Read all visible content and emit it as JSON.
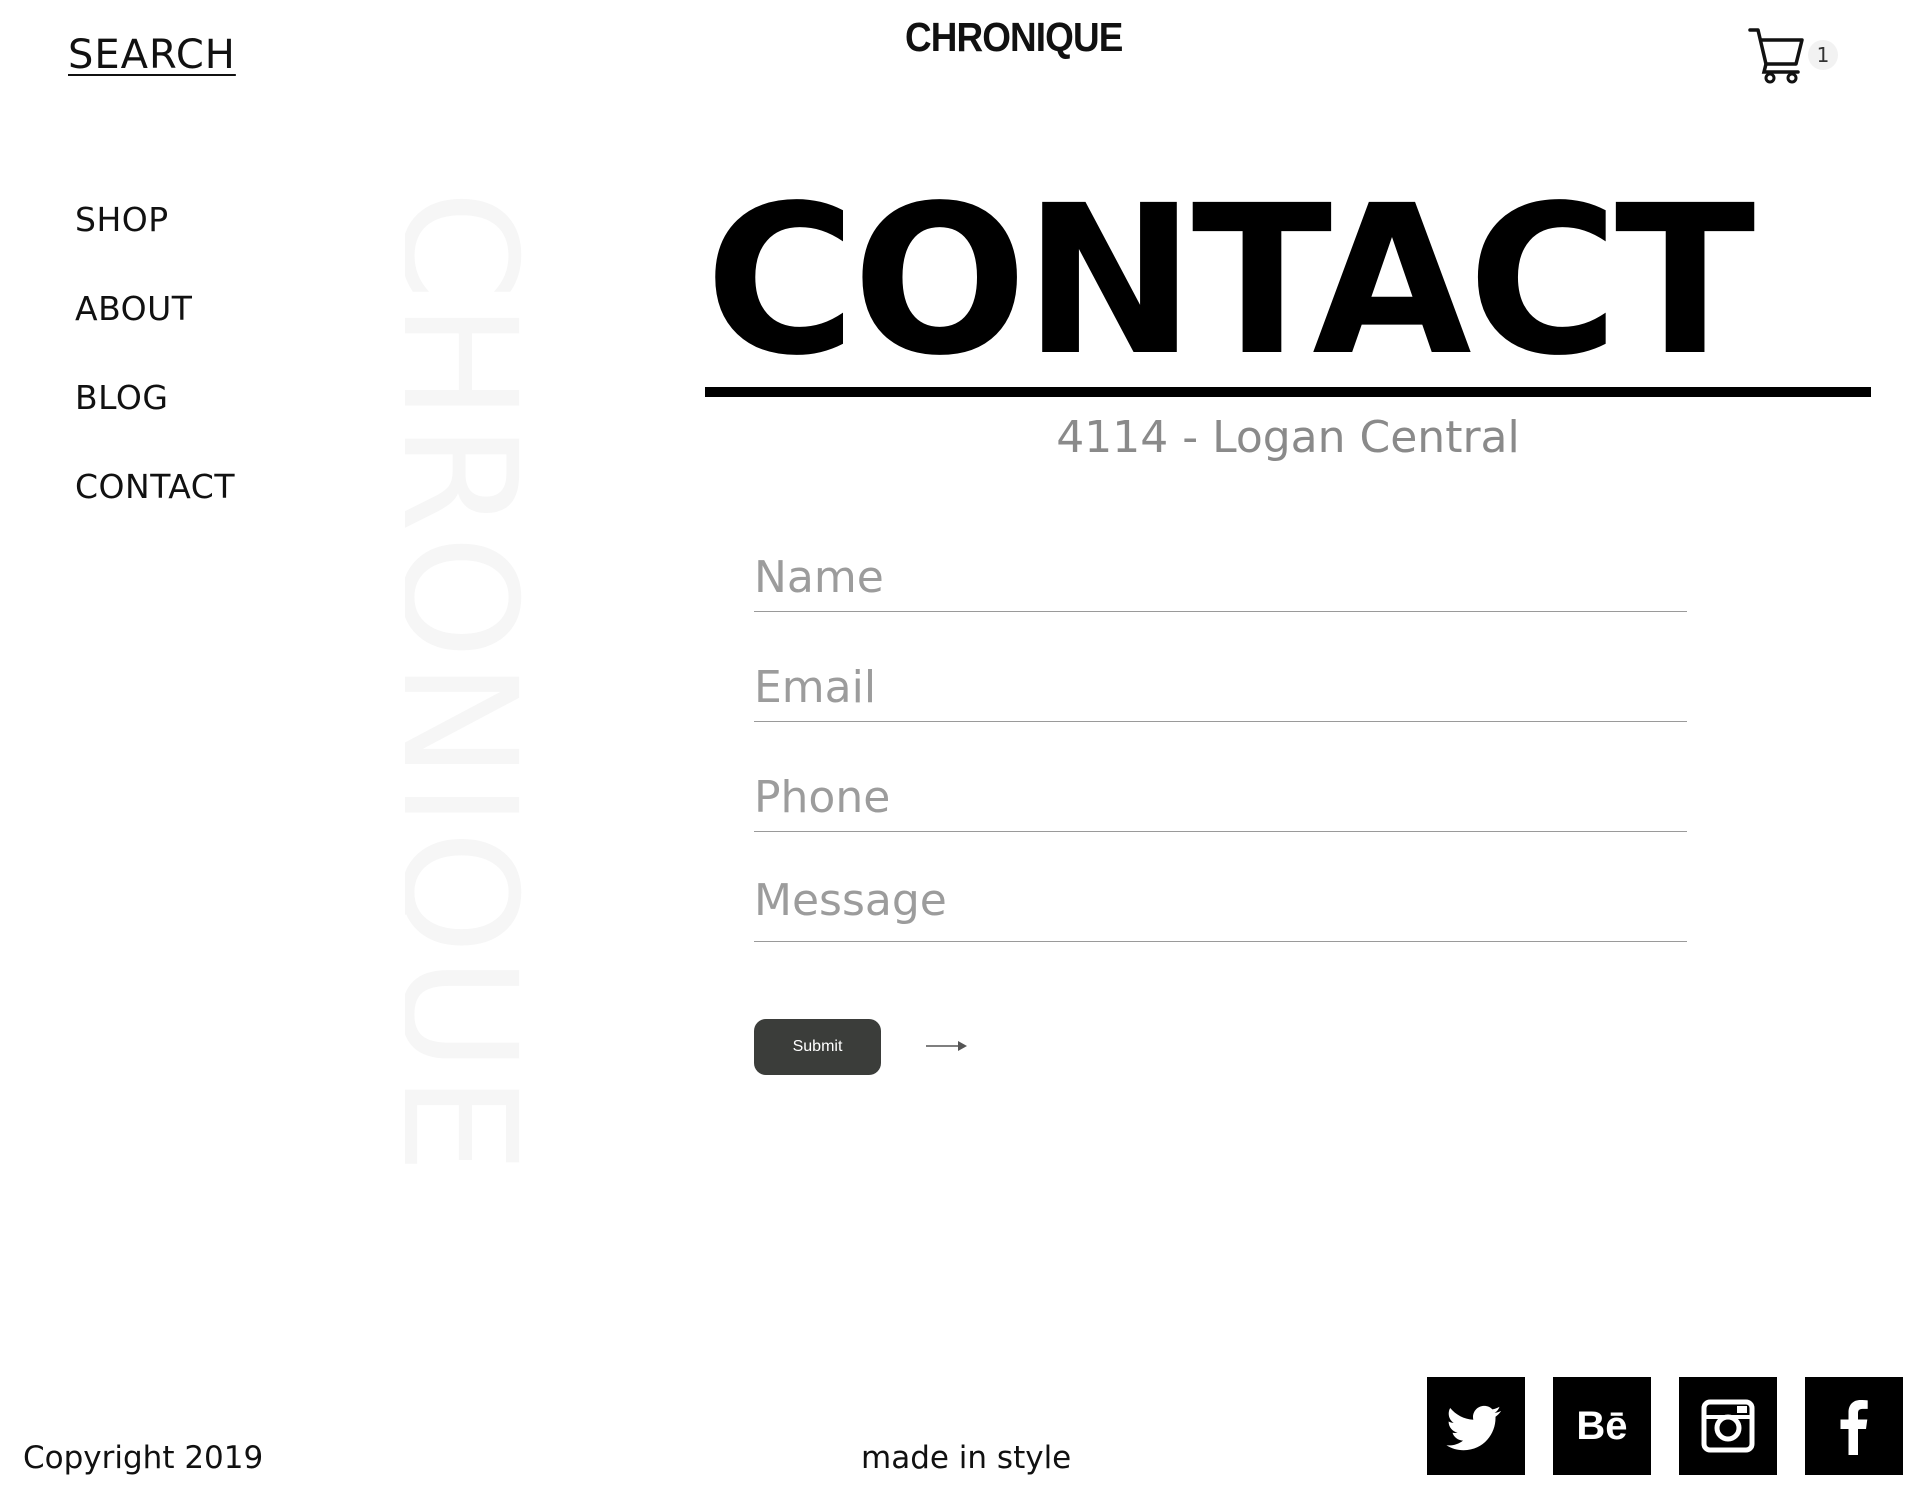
{
  "header": {
    "search_label": "SEARCH",
    "logo_text": "CHRONIQUE",
    "cart_count": "1"
  },
  "nav": {
    "items": [
      {
        "label": "SHOP"
      },
      {
        "label": "ABOUT"
      },
      {
        "label": "BLOG"
      },
      {
        "label": "CONTACT"
      }
    ]
  },
  "watermark": "CHRONIQUE",
  "main": {
    "heading": "CONTACT",
    "subtitle": "4114 - Logan Central"
  },
  "form": {
    "name_placeholder": "Name",
    "email_placeholder": "Email",
    "phone_placeholder": "Phone",
    "message_placeholder": "Message",
    "submit_label": "Submit"
  },
  "footer": {
    "copyright": "Copyright 2019",
    "tagline": "made in style",
    "social": [
      "twitter-icon",
      "behance-icon",
      "instagram-icon",
      "facebook-icon"
    ],
    "behance_text": "Bē"
  },
  "colors": {
    "accent": "#000000",
    "button": "#3b3d3a",
    "muted_text": "#8a8a8a",
    "watermark": "#f6f6f6"
  }
}
